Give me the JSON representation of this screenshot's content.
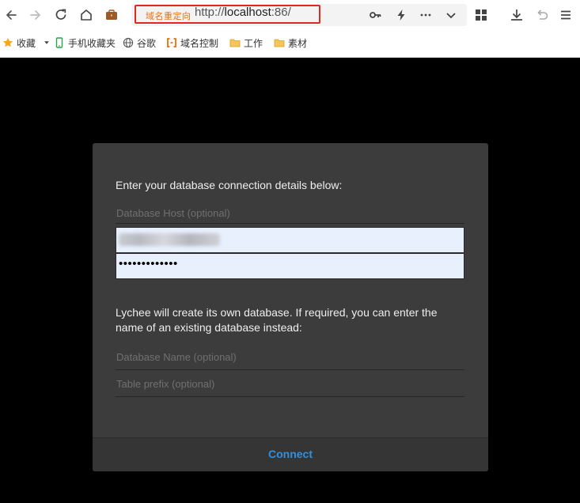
{
  "browser": {
    "nav": {
      "back_icon": "arrow-left-icon",
      "forward_icon": "arrow-right-icon",
      "reload_icon": "reload-icon",
      "home_icon": "home-icon",
      "briefcase_icon": "briefcase-icon"
    },
    "address_bar": {
      "redirect_label": "域名重定向",
      "url_prefix": "http://",
      "url_host": "localhost",
      "url_suffix": ":86/",
      "highlight_color": "#e1281e"
    },
    "url_actions": [
      "key-icon",
      "lightning-icon",
      "more-icon",
      "chevron-down-icon"
    ],
    "toolbar_icons": [
      "apps-icon",
      "download-icon",
      "undo-icon",
      "menu-icon"
    ]
  },
  "bookmarks": [
    {
      "label": "收藏",
      "icon": "star-icon"
    },
    {
      "label": "手机收藏夹",
      "icon": "phone-icon"
    },
    {
      "label": "谷歌",
      "icon": "globe-icon"
    },
    {
      "label": "域名控制",
      "icon": "bracket-icon"
    },
    {
      "label": "工作",
      "icon": "folder-icon"
    },
    {
      "label": "素材",
      "icon": "folder-icon"
    }
  ],
  "dialog": {
    "intro": "Enter your database connection details below:",
    "host_placeholder": "Database Host (optional)",
    "user_value": "",
    "password_value": "•••••••••••••",
    "info": "Lychee will create its own database. If required, you can enter the name of an existing database instead:",
    "dbname_placeholder": "Database Name (optional)",
    "prefix_placeholder": "Table prefix (optional)",
    "connect_label": "Connect",
    "accent_color": "#2f8fe0"
  }
}
